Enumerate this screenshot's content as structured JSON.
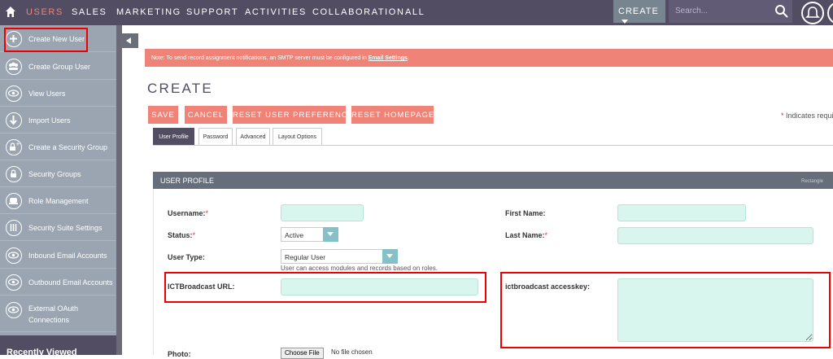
{
  "nav": {
    "items": [
      "USERS",
      "SALES",
      "MARKETING",
      "SUPPORT",
      "ACTIVITIES",
      "COLLABORATION",
      "ALL"
    ],
    "create_label": "CREATE",
    "search_placeholder": "Search..."
  },
  "sidebar": {
    "items": [
      {
        "label": "Create New User",
        "icon": "plus-circle-icon"
      },
      {
        "label": "Create Group User",
        "icon": "group-icon"
      },
      {
        "label": "View Users",
        "icon": "eye-icon"
      },
      {
        "label": "Import Users",
        "icon": "download-arrow-icon"
      },
      {
        "label": "Create a Security Group",
        "icon": "lock-plus-icon"
      },
      {
        "label": "Security Groups",
        "icon": "lock-icon"
      },
      {
        "label": "Role Management",
        "icon": "role-icon"
      },
      {
        "label": "Security Suite Settings",
        "icon": "settings-bars-icon"
      },
      {
        "label": "Inbound Email Accounts",
        "icon": "eye-icon"
      },
      {
        "label": "Outbound Email Accounts",
        "icon": "eye-icon"
      },
      {
        "label": "External OAuth Connections",
        "icon": "eye-icon"
      }
    ],
    "recently_viewed": "Recently Viewed"
  },
  "notice": {
    "text": "Note: To send record assignment notifications, an SMTP server must be configured in ",
    "link": "Email Settings",
    "end": "."
  },
  "page_title": "CREATE",
  "buttons": {
    "save": "SAVE",
    "cancel": "CANCEL",
    "reset_prefs": "RESET USER PREFERENCES",
    "reset_home": "RESET HOMEPAGE"
  },
  "required_note": "Indicates requi",
  "tabs": [
    "User Profile",
    "Password",
    "Advanced",
    "Layout Options"
  ],
  "panel": {
    "title": "USER PROFILE",
    "right_text": "Rectangle"
  },
  "form": {
    "username_label": "Username:",
    "status_label": "Status:",
    "status_value": "Active",
    "user_type_label": "User Type:",
    "user_type_value": "Regular User",
    "user_type_hint": "User can access modules and records based on roles.",
    "ict_url_label": "ICTBroadcast URL:",
    "first_name_label": "First Name:",
    "last_name_label": "Last Name:",
    "ict_key_label": "ictbroadcast accesskey:",
    "photo_label": "Photo:",
    "file_button": "Choose File",
    "file_text": "No file chosen"
  },
  "colors": {
    "nav_bg": "#534d64",
    "accent": "#f08377",
    "sidebar_bg": "#9aa5b1",
    "field_bg": "#d8f5ee",
    "highlight": "#e00000"
  }
}
